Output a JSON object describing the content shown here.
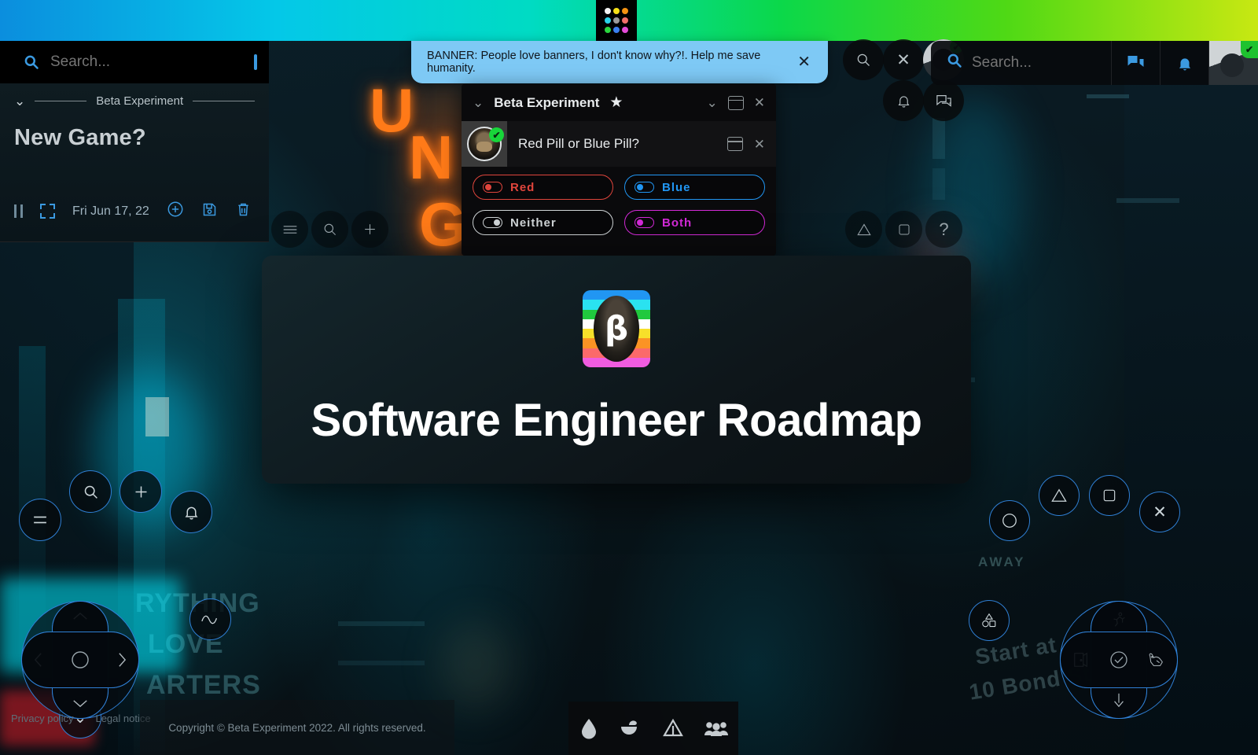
{
  "topbar": {
    "gradient": "linear-gradient(90deg,#0b8ede,#04c8e8,#00dbc4,#0bd84a,#4fd915,#c8e812)",
    "app_launcher": {
      "name": "app-launcher",
      "dots": [
        "#f2f2f2",
        "#f5e017",
        "#f59211",
        "#2ad2e8",
        "#9a9a9a",
        "#f2706b",
        "#2ad63f",
        "#3a7ff0",
        "#e44bd8"
      ]
    }
  },
  "left_panel": {
    "search": {
      "placeholder": "Search...",
      "value": ""
    },
    "section_label": "Beta Experiment",
    "title": "New Game?",
    "date": "Fri Jun 17, 22",
    "icons": {
      "menu": "hamburger-icon",
      "search": "search-icon",
      "panel": "panel-layout-icon",
      "pause": "pause-icon",
      "expand": "fullscreen-icon",
      "add": "plus-circle-icon",
      "save": "floppy-save-icon",
      "delete": "trash-icon"
    }
  },
  "banner": {
    "prefix": "BANNER:",
    "message": " People love banners, I don't know why?!. Help me save humanity.",
    "close_label": "✕",
    "bg": "#7ec9f5"
  },
  "beta_window": {
    "title": "Beta Experiment",
    "star": "★",
    "chevron": "⌄",
    "close_label": "✕",
    "sub_window": {
      "title": "Red Pill or Blue Pill?",
      "close_label": "✕",
      "verified": true
    },
    "options": [
      {
        "label": "Red",
        "color": "#e0453c",
        "toggle": "on"
      },
      {
        "label": "Blue",
        "color": "#2196f3",
        "toggle": "on"
      },
      {
        "label": "Neither",
        "color": "#cfd4d6",
        "toggle": "off"
      },
      {
        "label": "Both",
        "color": "#d42ad8",
        "toggle": "on"
      }
    ]
  },
  "modal": {
    "title": "Software Engineer Roadmap",
    "logo": {
      "symbol": "β",
      "stripes": [
        "#f05ce0",
        "#fb6a6a",
        "#fb9324",
        "#f7e02a",
        "#ffffff",
        "#20c93e",
        "#2ae2f0",
        "#2196f3"
      ]
    }
  },
  "fabs": {
    "center_left_cluster": [
      {
        "name": "menu-fab",
        "icon": "hamburger-icon"
      },
      {
        "name": "search-fab",
        "icon": "search-icon"
      },
      {
        "name": "add-fab",
        "icon": "plus-icon"
      }
    ],
    "center_right_cluster": [
      {
        "name": "triangle-fab",
        "icon": "triangle-icon"
      },
      {
        "name": "square-fab",
        "icon": "square-icon"
      },
      {
        "name": "help-fab",
        "icon": "question-mark-icon",
        "glyph": "?"
      }
    ],
    "top_right_cluster": [
      {
        "name": "search-fab",
        "icon": "search-icon"
      },
      {
        "name": "close-fab",
        "icon": "close-icon",
        "glyph": "✕"
      },
      {
        "name": "notifications-fab",
        "icon": "bell-icon"
      },
      {
        "name": "messages-fab",
        "icon": "chat-icon"
      }
    ],
    "bottom_left_cluster": [
      {
        "name": "menu-fab",
        "icon": "hamburger-icon"
      },
      {
        "name": "search-fab",
        "icon": "search-icon"
      },
      {
        "name": "add-fab",
        "icon": "plus-icon"
      },
      {
        "name": "notifications-fab",
        "icon": "bell-icon"
      },
      {
        "name": "wave-fab",
        "icon": "sine-wave-icon"
      },
      {
        "name": "collapse-fab",
        "icon": "chevron-down-icon",
        "glyph": "⌄"
      }
    ],
    "bottom_right_cluster": [
      {
        "name": "circle-fab",
        "icon": "circle-icon"
      },
      {
        "name": "triangle-fab",
        "icon": "triangle-icon"
      },
      {
        "name": "square-fab",
        "icon": "square-icon"
      },
      {
        "name": "close-fab",
        "icon": "close-icon",
        "glyph": "✕"
      },
      {
        "name": "shapes-fab",
        "icon": "shapes-icon"
      }
    ]
  },
  "dpad_left": {
    "up": "chevron-up-icon",
    "down": "chevron-down-icon",
    "left": "chevron-left-icon",
    "right": "chevron-right-icon",
    "center": "circle-icon"
  },
  "dpad_right": {
    "up": "running-person-icon",
    "down": "down-arrow-icon",
    "left": "door-exit-icon",
    "right": "animal-icon",
    "center": "clock-check-icon"
  },
  "right_top": {
    "search": {
      "placeholder": "Search...",
      "value": ""
    },
    "messages": "chat-icon",
    "notifications": "bell-icon",
    "avatar": "user-avatar",
    "verified": true
  },
  "bottom_toolbar": [
    {
      "name": "water-drop-icon",
      "label": "water"
    },
    {
      "name": "food-bowl-icon",
      "label": "food"
    },
    {
      "name": "tent-icon",
      "label": "shelter"
    },
    {
      "name": "people-group-icon",
      "label": "community"
    }
  ],
  "footer": {
    "privacy": "Privacy policy",
    "legal": "Legal notice",
    "copyright": "Copyright © Beta Experiment 2022. All rights reserved."
  }
}
